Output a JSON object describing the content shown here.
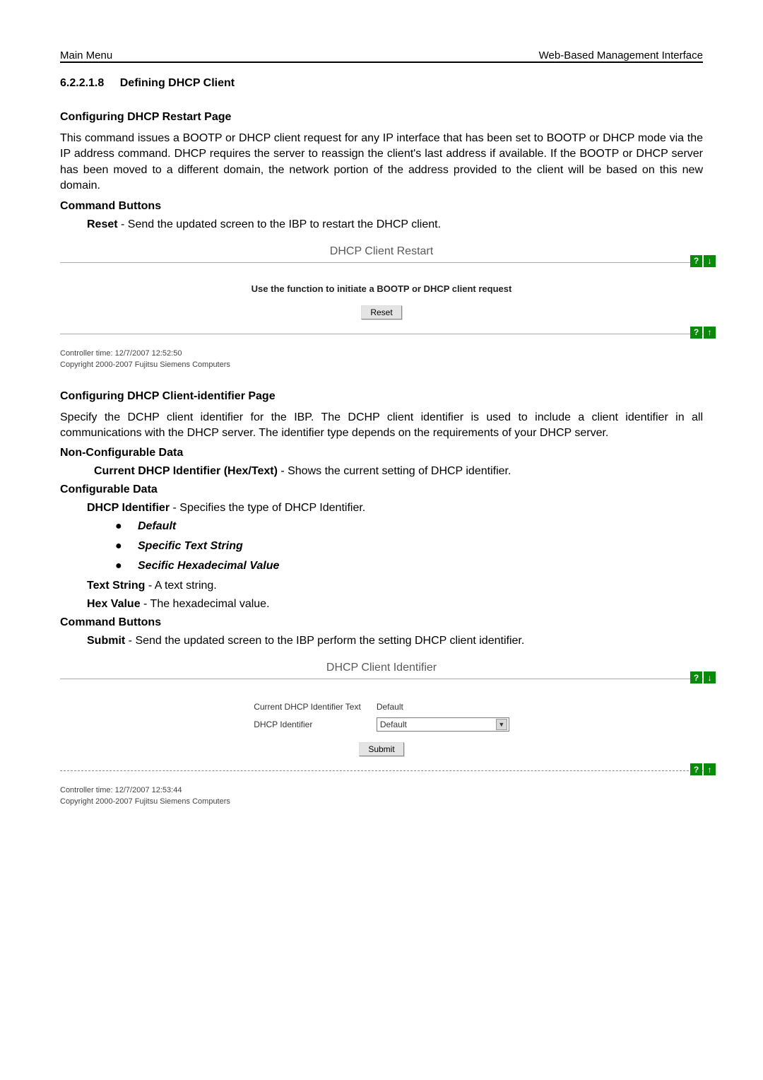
{
  "header": {
    "left": "Main Menu",
    "right": "Web-Based Management Interface"
  },
  "section": {
    "number": "6.2.2.1.8",
    "title": "Defining DHCP Client"
  },
  "restart": {
    "heading": "Configuring DHCP Restart Page",
    "body": "This command issues a BOOTP or DHCP client request for any IP interface that has been set to BOOTP or DHCP mode via the IP address command. DHCP requires the server to reassign the client's last address if available. If the BOOTP or DHCP server has been moved to a different domain, the network portion of the address provided to the client will be based on this new domain.",
    "cmdLabel": "Command Buttons",
    "resetDesc": "Reset - Send the updated screen to the IBP to restart the DHCP client."
  },
  "restartShot": {
    "title": "DHCP Client Restart",
    "subtitle": "Use the function to initiate a BOOTP or DHCP client request",
    "resetBtn": "Reset",
    "footer1": "Controller time: 12/7/2007 12:52:50",
    "footer2": "Copyright 2000-2007 Fujitsu Siemens Computers",
    "helpIcon": "?",
    "downIcon": "↓",
    "upIcon": "↑"
  },
  "identifier": {
    "heading": "Configuring DHCP Client-identifier Page",
    "body": "Specify the DCHP client identifier for the IBP. The DCHP client identifier is used to include a client identifier in all communications with the DHCP server. The identifier type depends on the requirements of your DHCP server.",
    "nonConfigLabel": "Non-Configurable Data",
    "currentDesc": "Current DHCP Identifier (Hex/Text) - Shows the current setting of DHCP identifier.",
    "configLabel": "Configurable Data",
    "dhcpIdDesc": "DHCP Identifier - Specifies the type of DHCP Identifier.",
    "bullets": [
      "Default",
      "Specific Text String",
      "Secific Hexadecimal Value"
    ],
    "textStringDesc": "Text String - A text string.",
    "hexValueDesc": "Hex Value - The hexadecimal value.",
    "cmdLabel": "Command Buttons",
    "submitDesc": "Submit - Send the updated screen to the IBP perform the setting DHCP client identifier."
  },
  "identifierShot": {
    "title": "DHCP Client Identifier",
    "row1Label": "Current DHCP Identifier Text",
    "row1Value": "Default",
    "row2Label": "DHCP Identifier",
    "row2Value": "Default",
    "submitBtn": "Submit",
    "footer1": "Controller time: 12/7/2007 12:53:44",
    "footer2": "Copyright 2000-2007 Fujitsu Siemens Computers",
    "helpIcon": "?",
    "downIcon": "↓",
    "upIcon": "↑"
  }
}
